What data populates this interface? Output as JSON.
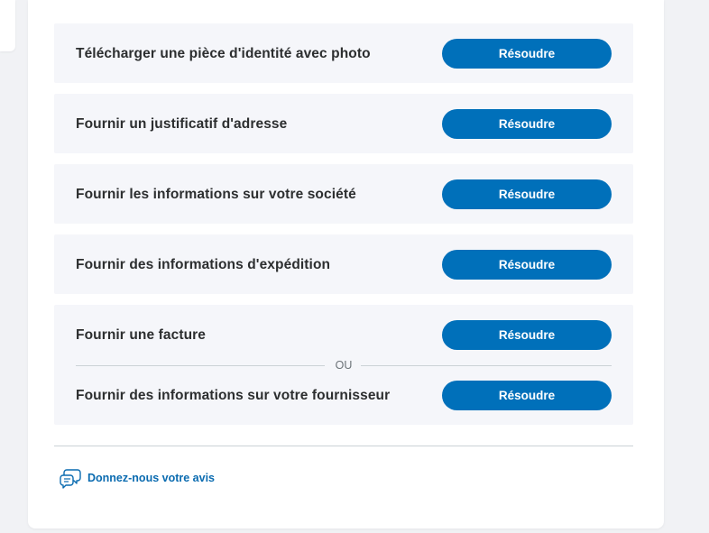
{
  "tasks": [
    {
      "label": "Télécharger une pièce d'identité avec photo",
      "button": "Résoudre"
    },
    {
      "label": "Fournir un justificatif d'adresse",
      "button": "Résoudre"
    },
    {
      "label": "Fournir les informations sur votre société",
      "button": "Résoudre"
    },
    {
      "label": "Fournir des informations d'expédition",
      "button": "Résoudre"
    }
  ],
  "choice_group": {
    "option_a": {
      "label": "Fournir une facture",
      "button": "Résoudre"
    },
    "separator": "OU",
    "option_b": {
      "label": "Fournir des informations sur votre fournisseur",
      "button": "Résoudre"
    }
  },
  "feedback": {
    "label": "Donnez-nous votre avis",
    "icon": "chat-bubbles-icon"
  },
  "colors": {
    "primary_button": "#0070ba",
    "row_background": "#f5f6fa",
    "link": "#0a6bb0",
    "text": "#2c2e2f"
  }
}
